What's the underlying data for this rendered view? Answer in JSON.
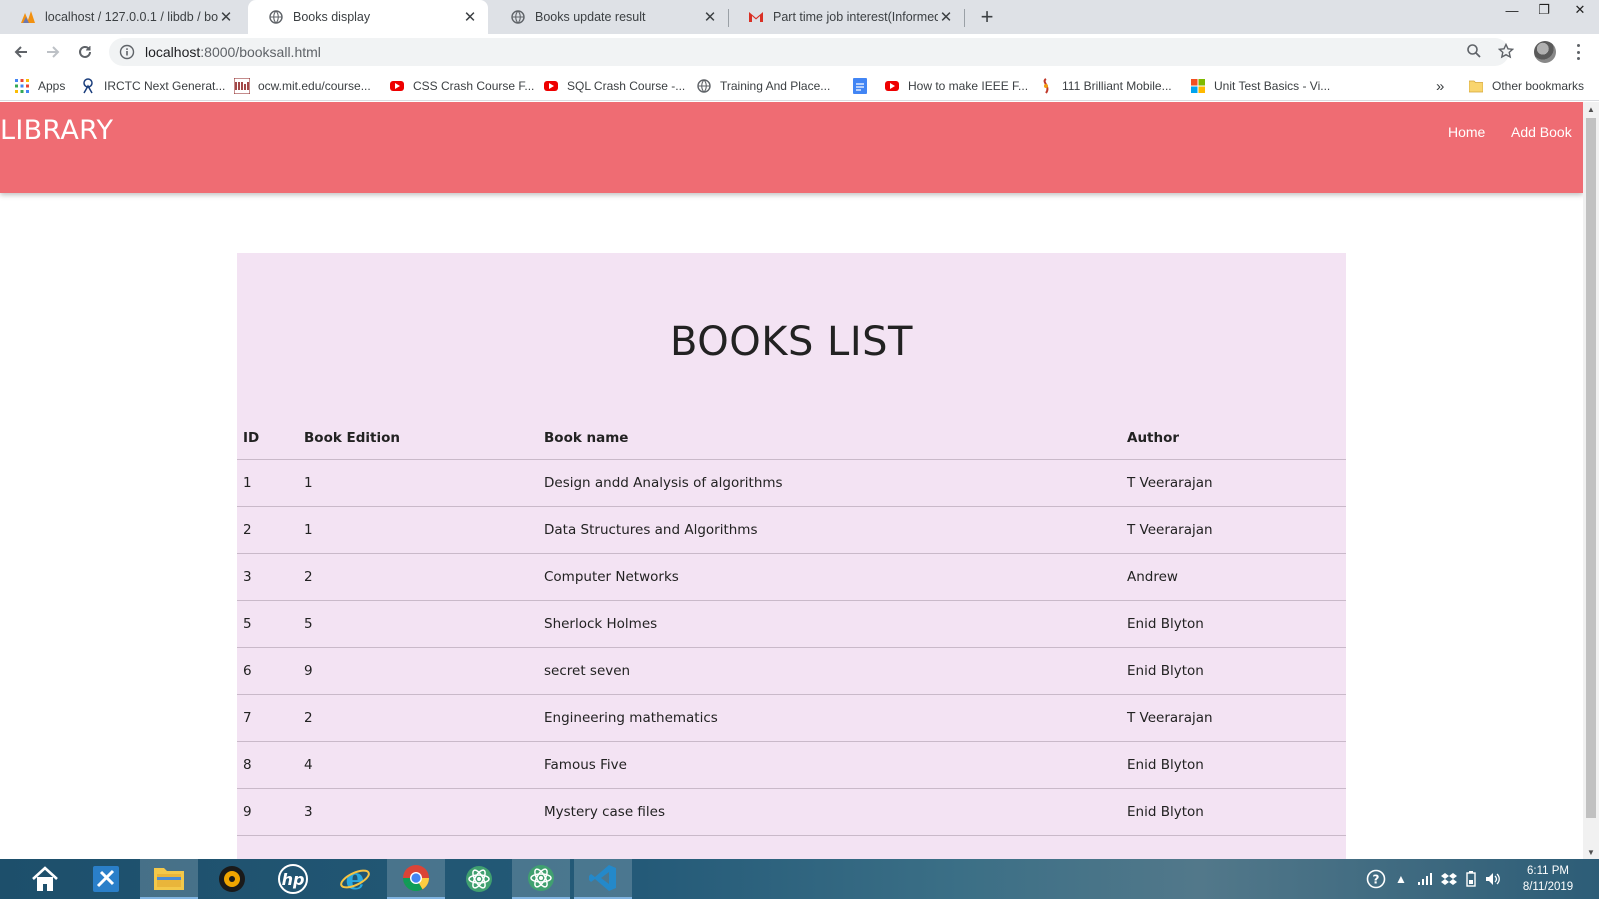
{
  "browser": {
    "tabs": [
      {
        "title": "localhost / 127.0.0.1 / libdb / boo",
        "icon": "phpmyadmin-icon"
      },
      {
        "title": "Books display",
        "icon": "globe-icon"
      },
      {
        "title": "Books update result",
        "icon": "globe-icon"
      },
      {
        "title": "Part time job interest(Informed b",
        "icon": "gmail-icon"
      }
    ],
    "url_host": "localhost",
    "url_rest": ":8000/booksall.html",
    "bookmarks": [
      {
        "label": "Apps",
        "icon": "apps-grid-icon"
      },
      {
        "label": "IRCTC Next Generat...",
        "icon": "irctc-icon"
      },
      {
        "label": "ocw.mit.edu/course...",
        "icon": "mit-icon"
      },
      {
        "label": "CSS Crash Course F...",
        "icon": "youtube-icon"
      },
      {
        "label": "SQL Crash Course -...",
        "icon": "youtube-icon"
      },
      {
        "label": "Training And Place...",
        "icon": "globe-icon"
      },
      {
        "label": "How to make IEEE F...",
        "icon": "youtube-icon"
      },
      {
        "label": "111 Brilliant Mobile...",
        "icon": "site-icon"
      },
      {
        "label": "Unit Test Basics - Vi...",
        "icon": "microsoft-icon"
      }
    ],
    "other_bookmarks": "Other bookmarks",
    "overflow": "»"
  },
  "page": {
    "brand": "LIBRARY",
    "nav": [
      {
        "label": "Home"
      },
      {
        "label": "Add Book"
      }
    ],
    "heading": "BOOKS LIST",
    "table": {
      "headers": [
        "ID",
        "Book Edition",
        "Book name",
        "Author"
      ],
      "rows": [
        [
          "1",
          "1",
          "Design andd Analysis of algorithms",
          "T Veerarajan"
        ],
        [
          "2",
          "1",
          "Data Structures and Algorithms",
          "T Veerarajan"
        ],
        [
          "3",
          "2",
          "Computer Networks",
          "Andrew"
        ],
        [
          "5",
          "5",
          "Sherlock Holmes",
          "Enid Blyton"
        ],
        [
          "6",
          "9",
          "secret seven",
          "Enid Blyton"
        ],
        [
          "7",
          "2",
          "Engineering mathematics",
          "T Veerarajan"
        ],
        [
          "8",
          "4",
          "Famous Five",
          "Enid Blyton"
        ],
        [
          "9",
          "3",
          "Mystery case files",
          "Enid Blyton"
        ]
      ]
    }
  },
  "taskbar": {
    "time": "6:11 PM",
    "date": "8/11/2019"
  },
  "colors": {
    "navbar": "#ef6c73",
    "panel": "#f3e3f3",
    "tab_strip": "#dee1e6"
  }
}
